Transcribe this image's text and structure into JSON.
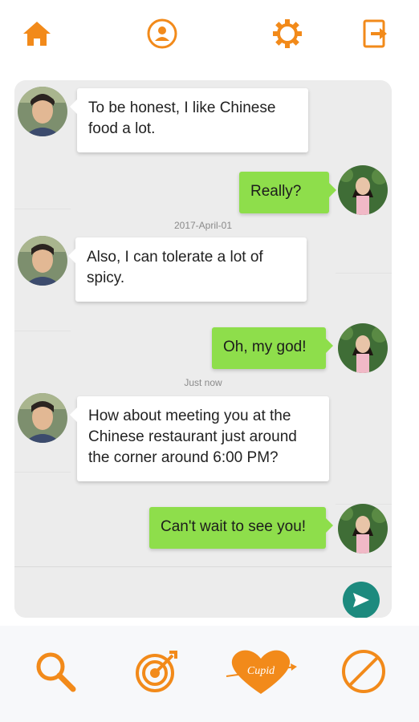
{
  "top_nav": {
    "icons": [
      "home-icon",
      "profile-icon",
      "gear-icon",
      "logout-icon"
    ],
    "accent_color": "#f28a1a"
  },
  "chat": {
    "messages": [
      {
        "side": "incoming",
        "text": "To be honest, I like Chinese food a lot."
      },
      {
        "side": "outgoing",
        "text": "Really?"
      },
      {
        "side": "incoming",
        "text": "Also, I can tolerate a lot of spicy."
      },
      {
        "side": "outgoing",
        "text": "Oh, my god!"
      },
      {
        "side": "incoming",
        "text": "How about meeting you at the Chinese restaurant just around the corner around 6:00 PM?"
      },
      {
        "side": "outgoing",
        "text": "Can't wait to see you!"
      }
    ],
    "timestamps": [
      "2017-April-01",
      "Just now"
    ],
    "incoming_bubble_color": "#ffffff",
    "outgoing_bubble_color": "#8ede4b"
  },
  "composer": {
    "send_icon": "send-icon",
    "send_color": "#1d8a7e"
  },
  "bottom_nav": {
    "icons": [
      "search-icon",
      "target-icon",
      "cupid-heart-icon",
      "block-icon"
    ],
    "heart_label": "Cupid"
  }
}
